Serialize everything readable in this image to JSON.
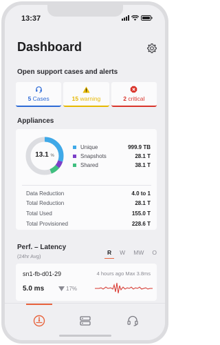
{
  "status_bar": {
    "time": "13:37"
  },
  "header": {
    "title": "Dashboard"
  },
  "alerts": {
    "section_title": "Open support cases and alerts",
    "cases": {
      "count": "5",
      "label": "Cases",
      "color": "#2d6ad6"
    },
    "warning": {
      "count": "15",
      "label": "warning",
      "color": "#e6b800"
    },
    "critical": {
      "count": "2",
      "label": "critical",
      "color": "#d9342b"
    }
  },
  "appliances": {
    "section_title": "Appliances",
    "donut": {
      "value": "13.1",
      "unit": "%"
    },
    "legend": [
      {
        "name": "Unique",
        "value": "999.9 TB",
        "color": "#3fa9e8"
      },
      {
        "name": "Snapshots",
        "value": "28.1 T",
        "color": "#7b3fc8"
      },
      {
        "name": "Shared",
        "value": "38.1 T",
        "color": "#3fbf7f"
      }
    ],
    "stats": [
      {
        "name": "Data Reduction",
        "value": "4.0 to 1"
      },
      {
        "name": "Total Reduction",
        "value": "28.1 T"
      },
      {
        "name": "Total Used",
        "value": "155.0 T"
      },
      {
        "name": "Total Provisioned",
        "value": "228.6 T"
      }
    ]
  },
  "performance": {
    "section_title": "Perf. – Latency",
    "subtitle": "(24hr Avg)",
    "tabs": [
      "R",
      "W",
      "MW",
      "O"
    ],
    "active_tab": "R",
    "item": {
      "name": "sn1-fb-d01-29",
      "meta": "4 hours ago Max 3.8ms",
      "value": "5.0 ms",
      "delta": "17%"
    }
  },
  "tabbar": {
    "items": [
      {
        "icon": "dashboard-gauge-icon",
        "active": true
      },
      {
        "icon": "appliances-server-icon",
        "active": false
      },
      {
        "icon": "support-headset-icon",
        "active": false
      }
    ],
    "active_color": "#e8633d"
  }
}
